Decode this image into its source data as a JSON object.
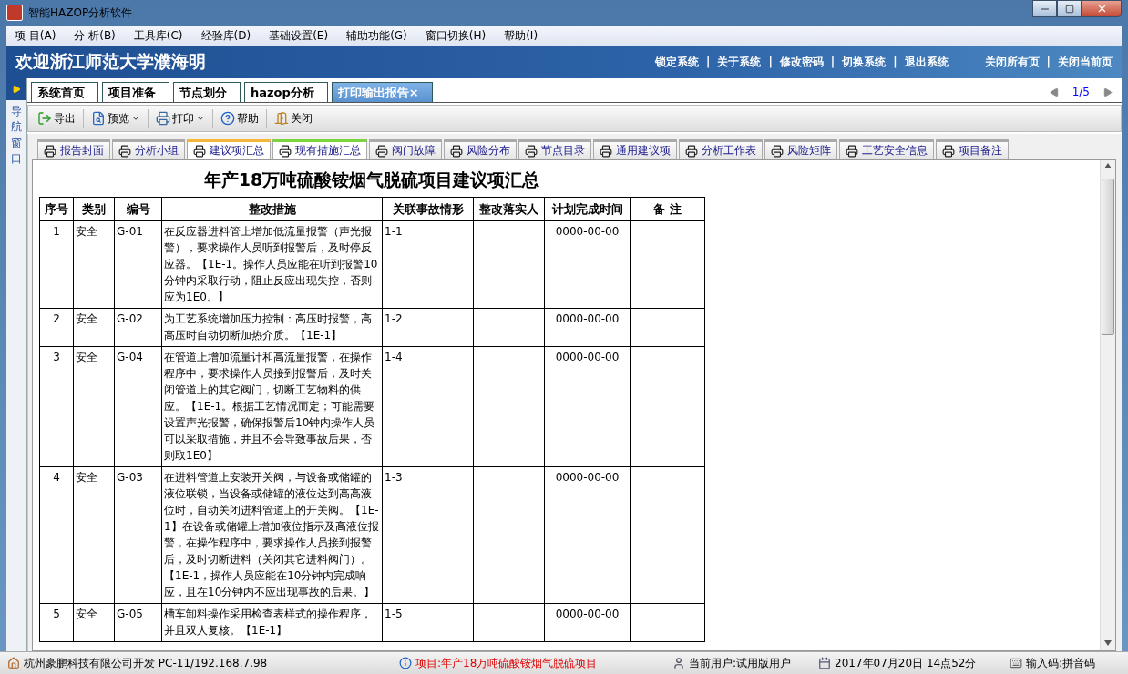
{
  "window": {
    "title": "智能HAZOP分析软件"
  },
  "menu": [
    "项 目(A)",
    "分 析(B)",
    "工具库(C)",
    "经验库(D)",
    "基础设置(E)",
    "辅助功能(G)",
    "窗口切换(H)",
    "帮助(I)"
  ],
  "banner": {
    "welcome": "欢迎浙江师范大学濮海明",
    "links": [
      "锁定系统",
      "|",
      "关于系统",
      "|",
      "修改密码",
      "|",
      "切换系统",
      "|",
      "退出系统"
    ],
    "page_links": [
      "关闭所有页",
      "|",
      "关闭当前页"
    ]
  },
  "nav": {
    "label": "导航窗口"
  },
  "main_tabs": [
    {
      "label": "系统首页",
      "selected": false
    },
    {
      "label": "项目准备",
      "selected": false
    },
    {
      "label": "节点划分",
      "selected": false
    },
    {
      "label": "hazop分析",
      "selected": false
    },
    {
      "label": "打印输出报告",
      "selected": true,
      "close": "×"
    }
  ],
  "pager": "1/5",
  "toolbar": [
    {
      "label": "导出",
      "kind": "export"
    },
    {
      "label": "预览",
      "kind": "preview"
    },
    {
      "label": "打印",
      "kind": "print"
    },
    {
      "label": "帮助",
      "kind": "help"
    },
    {
      "label": "关闭",
      "kind": "close"
    }
  ],
  "report_tabs": [
    {
      "label": "报告封面",
      "selected": false,
      "hovered": false
    },
    {
      "label": "分析小组",
      "selected": false,
      "hovered": false
    },
    {
      "label": "建议项汇总",
      "selected": true,
      "hovered": false
    },
    {
      "label": "现有措施汇总",
      "selected": false,
      "hovered": true
    },
    {
      "label": "阀门故障",
      "selected": false,
      "hovered": false
    },
    {
      "label": "风险分布",
      "selected": false,
      "hovered": false
    },
    {
      "label": "节点目录",
      "selected": false,
      "hovered": false
    },
    {
      "label": "通用建议项",
      "selected": false,
      "hovered": false
    },
    {
      "label": "分析工作表",
      "selected": false,
      "hovered": false
    },
    {
      "label": "风险矩阵",
      "selected": false,
      "hovered": false
    },
    {
      "label": "工艺安全信息",
      "selected": false,
      "hovered": false
    },
    {
      "label": "项目备注",
      "selected": false,
      "hovered": false
    }
  ],
  "report": {
    "title": "年产18万吨硫酸铵烟气脱硫项目建议项汇总",
    "columns": [
      "序号",
      "类别",
      "编号",
      "整改措施",
      "关联事故情形",
      "整改落实人",
      "计划完成时间",
      "备 注"
    ],
    "rows": [
      [
        "1",
        "安全",
        "G-01",
        "在反应器进料管上增加低流量报警（声光报警），要求操作人员听到报警后，及时停反应器。【1E-1。操作人员应能在听到报警10分钟内采取行动，阻止反应出现失控，否则应为1E0。】",
        "1-1",
        "",
        "0000-00-00",
        ""
      ],
      [
        "2",
        "安全",
        "G-02",
        "为工艺系统增加压力控制：高压时报警，高高压时自动切断加热介质。【1E-1】",
        "1-2",
        "",
        "0000-00-00",
        ""
      ],
      [
        "3",
        "安全",
        "G-04",
        "在管道上增加流量计和高流量报警，在操作程序中，要求操作人员接到报警后，及时关闭管道上的其它阀门，切断工艺物料的供应。【1E-1。根据工艺情况而定；可能需要设置声光报警，确保报警后10钟内操作人员可以采取措施，并且不会导致事故后果，否则取1E0】",
        "1-4",
        "",
        "0000-00-00",
        ""
      ],
      [
        "4",
        "安全",
        "G-03",
        "在进料管道上安装开关阀，与设备或储罐的液位联锁，当设备或储罐的液位达到高高液位时，自动关闭进料管道上的开关阀。【1E-1】在设备或储罐上增加液位指示及高液位报警，在操作程序中，要求操作人员接到报警后，及时切断进料（关闭其它进料阀门）。【1E-1，操作人员应能在10分钟内完成响应，且在10分钟内不应出现事故的后果。】",
        "1-3",
        "",
        "0000-00-00",
        ""
      ],
      [
        "5",
        "安全",
        "G-05",
        "槽车卸料操作采用检查表样式的操作程序，并且双人复核。【1E-1】",
        "1-5",
        "",
        "0000-00-00",
        ""
      ]
    ]
  },
  "status_bar": [
    {
      "text": "杭州豪鹏科技有限公司开发  PC-11/192.168.7.98",
      "kind": "company"
    },
    {
      "text": "项目:年产18万吨硫酸铵烟气脱硫项目",
      "kind": "project"
    },
    {
      "text": "当前用户:试用版用户",
      "kind": "user"
    },
    {
      "text": "2017年07月20日 14点52分",
      "kind": "time"
    },
    {
      "text": "输入码:拼音码",
      "kind": "input"
    }
  ]
}
